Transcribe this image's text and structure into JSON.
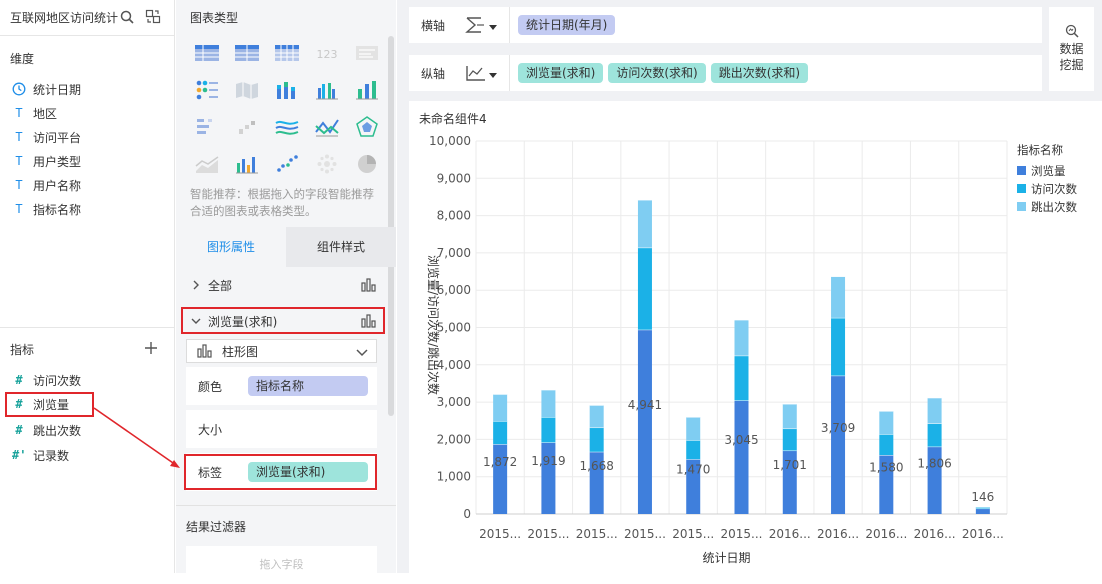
{
  "datasource": {
    "title": "互联网地区访问统计"
  },
  "dimensions": {
    "header": "维度",
    "items": [
      {
        "label": "统计日期",
        "icon": "clock-icon"
      },
      {
        "label": "地区",
        "icon": "text-type-icon"
      },
      {
        "label": "访问平台",
        "icon": "text-type-icon"
      },
      {
        "label": "用户类型",
        "icon": "text-type-icon"
      },
      {
        "label": "用户名称",
        "icon": "text-type-icon"
      },
      {
        "label": "指标名称",
        "icon": "text-type-icon"
      }
    ]
  },
  "metrics": {
    "header": "指标",
    "items": [
      {
        "label": "访问次数"
      },
      {
        "label": "浏览量"
      },
      {
        "label": "跳出次数"
      },
      {
        "label": "记录数"
      }
    ]
  },
  "chart_types": {
    "header": "图表类型",
    "hint": "智能推荐：根据拖入的字段智能推荐合适的图表或表格类型。"
  },
  "tabs": {
    "graph_props": "图形属性",
    "component_style": "组件样式"
  },
  "props": {
    "all_label": "全部",
    "measure_label": "浏览量(求和)",
    "chart_select": "柱形图",
    "color_label": "颜色",
    "color_chip": "指标名称",
    "size_label": "大小",
    "label_label": "标签",
    "label_chip": "浏览量(求和)"
  },
  "filter": {
    "header": "结果过滤器",
    "placeholder": "拖入字段"
  },
  "axes": {
    "x_label": "横轴",
    "x_chip": "统计日期(年月)",
    "y_label": "纵轴",
    "y_chips": [
      "浏览量(求和)",
      "访问次数(求和)",
      "跳出次数(求和)"
    ]
  },
  "mining": {
    "line1": "数据",
    "line2": "挖掘"
  },
  "widget": {
    "title": "未命名组件4"
  },
  "colors": {
    "pv": "#3f7fdc",
    "visits": "#1bb1e7",
    "bounce": "#7fcdf2",
    "red": "#e0262b"
  },
  "chart_data": {
    "type": "bar",
    "stacked": true,
    "categories": [
      "2015...",
      "2015...",
      "2015...",
      "2015...",
      "2015...",
      "2015...",
      "2016...",
      "2016...",
      "2016...",
      "2016...",
      "2016..."
    ],
    "series": [
      {
        "name": "浏览量",
        "values": [
          1872,
          1919,
          1668,
          4941,
          1470,
          3045,
          1701,
          3709,
          1580,
          1806,
          146
        ]
      },
      {
        "name": "访问次数",
        "values": [
          620,
          680,
          650,
          2200,
          510,
          1200,
          590,
          1550,
          560,
          620,
          40
        ]
      },
      {
        "name": "跳出次数",
        "values": [
          720,
          730,
          600,
          1280,
          620,
          960,
          660,
          1110,
          620,
          690,
          0
        ]
      }
    ],
    "data_labels": [
      "1,872",
      "1,919",
      "1,668",
      "4,941",
      "1,470",
      "3,045",
      "1,701",
      "3,709",
      "1,580",
      "1,806",
      "146"
    ],
    "y_ticks": [
      "0",
      "1,000",
      "2,000",
      "3,000",
      "4,000",
      "5,000",
      "6,000",
      "7,000",
      "8,000",
      "9,000",
      "10,000"
    ],
    "ylim": [
      0,
      10000
    ],
    "xlabel": "统计日期",
    "ylabel": "浏览量/访问次数/跳出次数",
    "legend_title": "指标名称",
    "legend": [
      "浏览量",
      "访问次数",
      "跳出次数"
    ],
    "legend_position": "top-right",
    "grid": true
  }
}
